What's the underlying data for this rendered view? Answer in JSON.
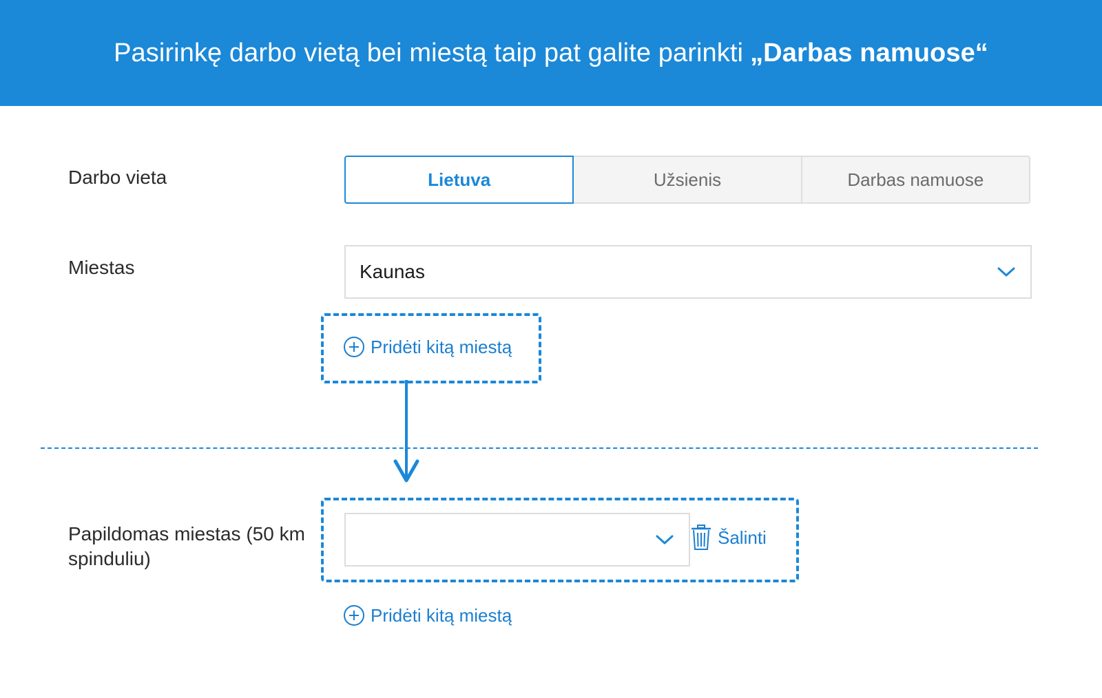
{
  "banner": {
    "text": "Pasirinkę darbo vietą bei miestą taip pat galite parinkti",
    "highlight": "„Darbas namuose“"
  },
  "work_place": {
    "label": "Darbo vieta",
    "options": [
      "Lietuva",
      "Užsienis",
      "Darbas namuose"
    ],
    "selected": "Lietuva"
  },
  "city": {
    "label": "Miestas",
    "value": "Kaunas"
  },
  "add_city_top": {
    "label": "Pridėti kitą miestą"
  },
  "extra_city": {
    "label_line1": "Papildomas miestas (50 km",
    "label_line2": "spinduliu)",
    "value": "",
    "remove_label": "Šalinti"
  },
  "add_city_bottom": {
    "label": "Pridėti kitą miestą"
  },
  "colors": {
    "accent": "#1b88d8",
    "link": "#1b7fd0",
    "segment_inactive_bg": "#f4f4f4",
    "border": "#dcdcdc"
  },
  "icons": [
    "plus-circle-icon",
    "chevron-down-icon",
    "trash-icon",
    "arrow-down-icon"
  ]
}
